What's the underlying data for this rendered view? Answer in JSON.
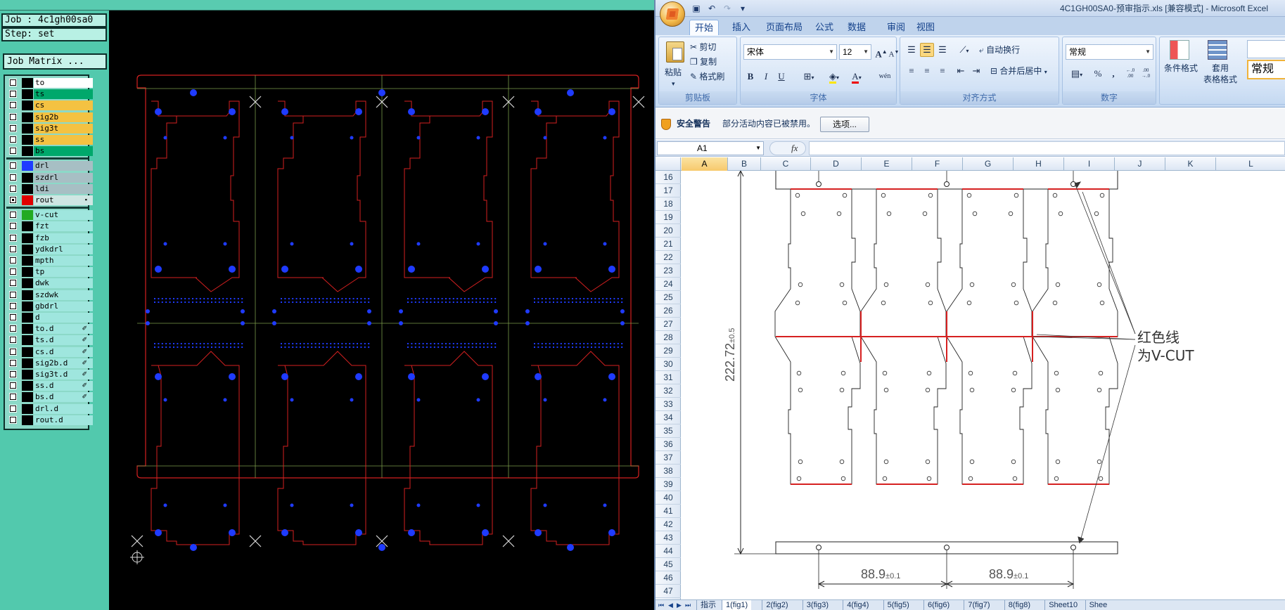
{
  "cam": {
    "job_label": "Job : 4c1gh00sa0",
    "step_label": "Step: set",
    "job_matrix_button": "Job Matrix ...",
    "layers": [
      {
        "name": "to",
        "bg": "#ffffff",
        "swatch": "#000000",
        "checked": false,
        "mark": ""
      },
      {
        "name": "ts",
        "bg": "#00a86b",
        "swatch": "#000000",
        "checked": false,
        "mark": ""
      },
      {
        "name": "cs",
        "bg": "#f4c242",
        "swatch": "#000000",
        "checked": false,
        "mark": ""
      },
      {
        "name": "sig2b",
        "bg": "#f4c242",
        "swatch": "#000000",
        "checked": false,
        "mark": ""
      },
      {
        "name": "sig3t",
        "bg": "#f4c242",
        "swatch": "#000000",
        "checked": false,
        "mark": ""
      },
      {
        "name": "ss",
        "bg": "#f4c242",
        "swatch": "#000000",
        "checked": false,
        "mark": ""
      },
      {
        "name": "bs",
        "bg": "#00a86b",
        "swatch": "#000000",
        "checked": false,
        "mark": ""
      },
      {
        "name": "drl",
        "bg": "#a7bfc4",
        "swatch": "#1f3bff",
        "checked": false,
        "mark": "",
        "sep": true
      },
      {
        "name": "szdrl",
        "bg": "#a7bfc4",
        "swatch": "#000000",
        "checked": false,
        "mark": ""
      },
      {
        "name": "ldi",
        "bg": "#a7bfc4",
        "swatch": "#000000",
        "checked": false,
        "mark": ""
      },
      {
        "name": "rout",
        "bg": "#cfe6e3",
        "swatch": "#e00000",
        "checked": true,
        "mark": "▪"
      },
      {
        "name": "v-cut",
        "bg": "#9fe6de",
        "swatch": "#22aa22",
        "checked": false,
        "mark": "",
        "sep": true
      },
      {
        "name": "fzt",
        "bg": "#9fe6de",
        "swatch": "#000000",
        "checked": false,
        "mark": ""
      },
      {
        "name": "fzb",
        "bg": "#9fe6de",
        "swatch": "#000000",
        "checked": false,
        "mark": ""
      },
      {
        "name": "ydkdrl",
        "bg": "#9fe6de",
        "swatch": "#000000",
        "checked": false,
        "mark": ""
      },
      {
        "name": "mpth",
        "bg": "#9fe6de",
        "swatch": "#000000",
        "checked": false,
        "mark": ""
      },
      {
        "name": "tp",
        "bg": "#9fe6de",
        "swatch": "#000000",
        "checked": false,
        "mark": ""
      },
      {
        "name": "dwk",
        "bg": "#9fe6de",
        "swatch": "#000000",
        "checked": false,
        "mark": ""
      },
      {
        "name": "szdwk",
        "bg": "#9fe6de",
        "swatch": "#000000",
        "checked": false,
        "mark": ""
      },
      {
        "name": "gbdrl",
        "bg": "#9fe6de",
        "swatch": "#000000",
        "checked": false,
        "mark": ""
      },
      {
        "name": "d",
        "bg": "#9fe6de",
        "swatch": "#000000",
        "checked": false,
        "mark": ""
      },
      {
        "name": "to.d",
        "bg": "#9fe6de",
        "swatch": "#000000",
        "checked": false,
        "mark": "✐"
      },
      {
        "name": "ts.d",
        "bg": "#9fe6de",
        "swatch": "#000000",
        "checked": false,
        "mark": "✐"
      },
      {
        "name": "cs.d",
        "bg": "#9fe6de",
        "swatch": "#000000",
        "checked": false,
        "mark": "✐"
      },
      {
        "name": "sig2b.d",
        "bg": "#9fe6de",
        "swatch": "#000000",
        "checked": false,
        "mark": "✐"
      },
      {
        "name": "sig3t.d",
        "bg": "#9fe6de",
        "swatch": "#000000",
        "checked": false,
        "mark": "✐"
      },
      {
        "name": "ss.d",
        "bg": "#9fe6de",
        "swatch": "#000000",
        "checked": false,
        "mark": "✐"
      },
      {
        "name": "bs.d",
        "bg": "#9fe6de",
        "swatch": "#000000",
        "checked": false,
        "mark": "✐"
      },
      {
        "name": "drl.d",
        "bg": "#9fe6de",
        "swatch": "#000000",
        "checked": false,
        "mark": ""
      },
      {
        "name": "rout.d",
        "bg": "#9fe6de",
        "swatch": "#000000",
        "checked": false,
        "mark": ""
      }
    ],
    "colors": {
      "rout": "#d42020",
      "drill": "#1f3bff",
      "vcut": "#7a9a4a",
      "fiducial": "#d9d9d9"
    }
  },
  "excel": {
    "window_title": "4C1GH00SA0-预审指示.xls [兼容模式] - Microsoft Excel",
    "tabs": [
      "开始",
      "插入",
      "页面布局",
      "公式",
      "数据",
      "审阅",
      "视图"
    ],
    "active_tab": "开始",
    "clipboard": {
      "paste": "粘贴",
      "cut": "剪切",
      "copy": "复制",
      "format_painter": "格式刷",
      "group": "剪贴板"
    },
    "font": {
      "name": "宋体",
      "size": "12",
      "group": "字体",
      "grow": "A",
      "shrink": "A",
      "bold": "B",
      "italic": "I",
      "underline": "U",
      "phonetic": "wén"
    },
    "alignment": {
      "wrap": "自动换行",
      "merge": "合并后居中",
      "group": "对齐方式"
    },
    "number": {
      "format": "常规",
      "percent": "%",
      "comma": ",",
      "group": "数字",
      "inc_decimal": "←.0 .00",
      "dec_decimal": ".00 →.0"
    },
    "styles": {
      "conditional": "条件格式",
      "table_line1": "套用",
      "table_line2": "表格格式",
      "cell_style": "常规"
    },
    "security": {
      "title": "安全警告",
      "message": "部分活动内容已被禁用。",
      "options_button": "选项..."
    },
    "name_box": "A1",
    "fx": "fx",
    "columns": [
      "A",
      "B",
      "C",
      "D",
      "E",
      "F",
      "G",
      "H",
      "I",
      "J",
      "K",
      "L"
    ],
    "selected_column": "A",
    "rows": [
      "16",
      "17",
      "18",
      "19",
      "20",
      "21",
      "22",
      "23",
      "24",
      "25",
      "26",
      "27",
      "28",
      "29",
      "30",
      "31",
      "32",
      "33",
      "34",
      "35",
      "36",
      "37",
      "38",
      "39",
      "40",
      "41",
      "42",
      "43",
      "44",
      "45",
      "46",
      "47"
    ],
    "drawing": {
      "height_dim": "222.72",
      "height_tol": "±0.5",
      "width_dim_1": "88.9",
      "width_tol_1": "±0.1",
      "width_dim_2": "88.9",
      "width_tol_2": "±0.1",
      "note_line1": "红色线",
      "note_line2": "为V-CUT"
    },
    "sheet_tabs": [
      "指示",
      "1(fig1)",
      "2(fig2)",
      "3(fig3)",
      "4(fig4)",
      "5(fig5)",
      "6(fig6)",
      "7(fig7)",
      "8(fig8)",
      "Sheet10",
      "Shee"
    ],
    "active_sheet": "1(fig1)"
  }
}
